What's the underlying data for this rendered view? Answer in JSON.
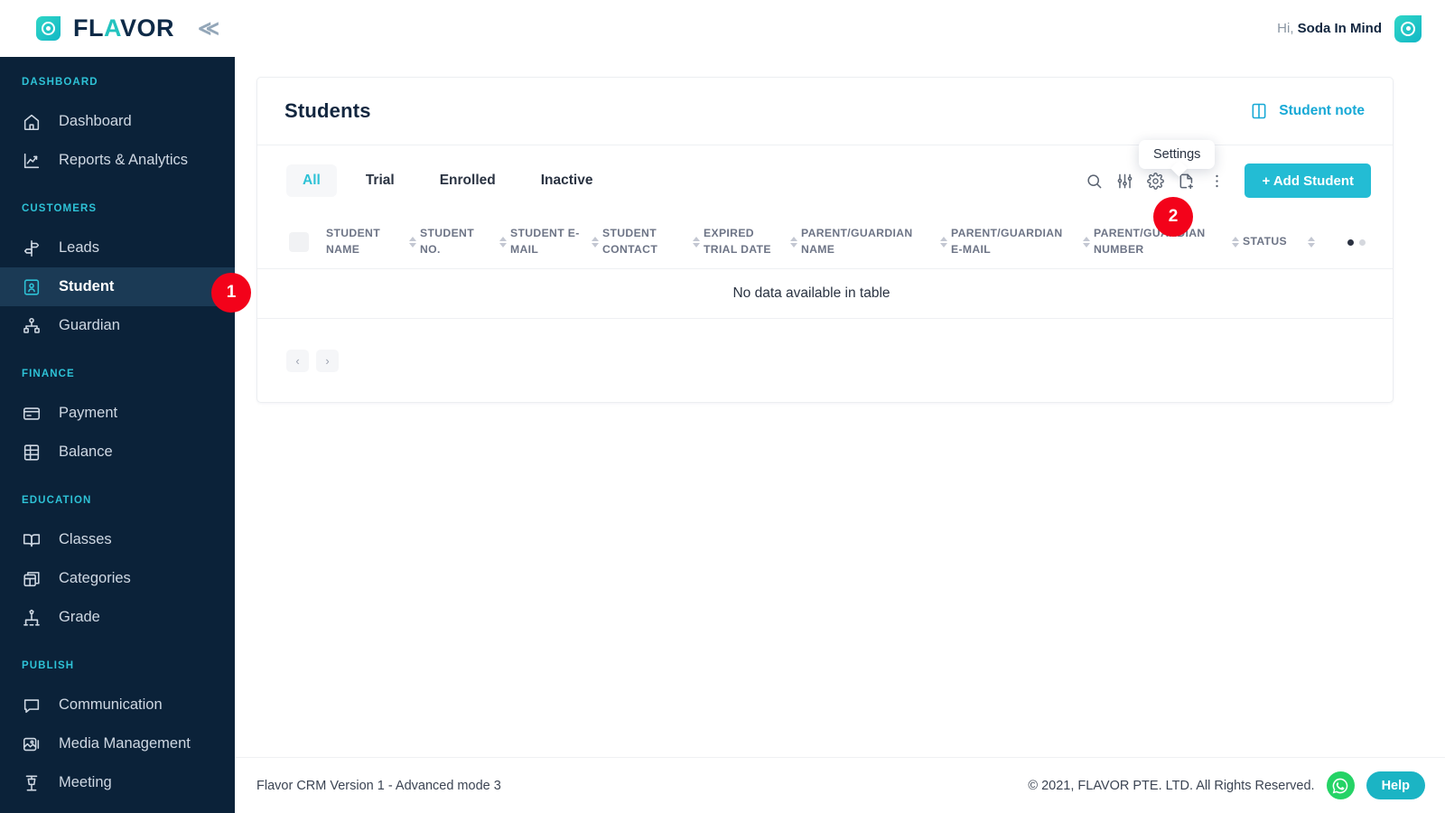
{
  "brand": {
    "logo_text_1": "FL",
    "logo_text_accent": "A",
    "logo_text_2": "VOR",
    "collapse_icon": "chevron-double-left-icon",
    "accent_color": "#2ec2d6",
    "sidebar_bg": "#0b2239"
  },
  "topbar": {
    "greeting_prefix": "Hi,",
    "user_name": "Soda In Mind",
    "avatar_icon": "flavor-avatar-icon"
  },
  "sidebar": {
    "groups": [
      {
        "label": "DASHBOARD",
        "items": [
          {
            "label": "Dashboard",
            "icon": "home-icon",
            "active": false
          },
          {
            "label": "Reports & Analytics",
            "icon": "chart-line-icon",
            "active": false
          }
        ]
      },
      {
        "label": "CUSTOMERS",
        "items": [
          {
            "label": "Leads",
            "icon": "signpost-icon",
            "active": false
          },
          {
            "label": "Student",
            "icon": "student-card-icon",
            "active": true
          },
          {
            "label": "Guardian",
            "icon": "guardian-icon",
            "active": false
          }
        ]
      },
      {
        "label": "FINANCE",
        "items": [
          {
            "label": "Payment",
            "icon": "credit-card-icon",
            "active": false
          },
          {
            "label": "Balance",
            "icon": "ledger-icon",
            "active": false
          }
        ]
      },
      {
        "label": "EDUCATION",
        "items": [
          {
            "label": "Classes",
            "icon": "book-open-icon",
            "active": false
          },
          {
            "label": "Categories",
            "icon": "boxes-icon",
            "active": false
          },
          {
            "label": "Grade",
            "icon": "grade-hierarchy-icon",
            "active": false
          }
        ]
      },
      {
        "label": "PUBLISH",
        "items": [
          {
            "label": "Communication",
            "icon": "chat-bubble-icon",
            "active": false
          },
          {
            "label": "Media Management",
            "icon": "image-stack-icon",
            "active": false
          },
          {
            "label": "Meeting",
            "icon": "podium-icon",
            "active": false
          }
        ]
      }
    ]
  },
  "card": {
    "title": "Students",
    "note_link_label": "Student note",
    "note_link_icon": "book-note-icon",
    "tabs": [
      {
        "label": "All",
        "active": true
      },
      {
        "label": "Trial",
        "active": false
      },
      {
        "label": "Enrolled",
        "active": false
      },
      {
        "label": "Inactive",
        "active": false
      }
    ],
    "tool_icons": [
      {
        "name": "search-icon"
      },
      {
        "name": "filter-sliders-icon"
      },
      {
        "name": "gear-icon"
      },
      {
        "name": "export-document-icon"
      },
      {
        "name": "kebab-menu-icon"
      }
    ],
    "add_button_label": "+ Add Student",
    "tooltip": "Settings",
    "columns": [
      "STUDENT NAME",
      "STUDENT NO.",
      "STUDENT E-MAIL",
      "STUDENT CONTACT",
      "EXPIRED TRIAL DATE",
      "PARENT/GUARDIAN NAME",
      "PARENT/GUARDIAN E-MAIL",
      "PARENT/GUARDIAN NUMBER",
      "STATUS"
    ],
    "empty_message": "No data available in table",
    "pagination": {
      "prev_label": "‹",
      "next_label": "›"
    }
  },
  "annotations": [
    {
      "id": "1",
      "target": "sidebar-item-student"
    },
    {
      "id": "2",
      "target": "gear-icon"
    }
  ],
  "footer": {
    "version_text": "Flavor CRM Version 1 - Advanced mode 3",
    "copyright": "© 2021, FLAVOR PTE. LTD. All Rights Reserved.",
    "whatsapp_icon": "whatsapp-icon",
    "help_label": "Help"
  }
}
